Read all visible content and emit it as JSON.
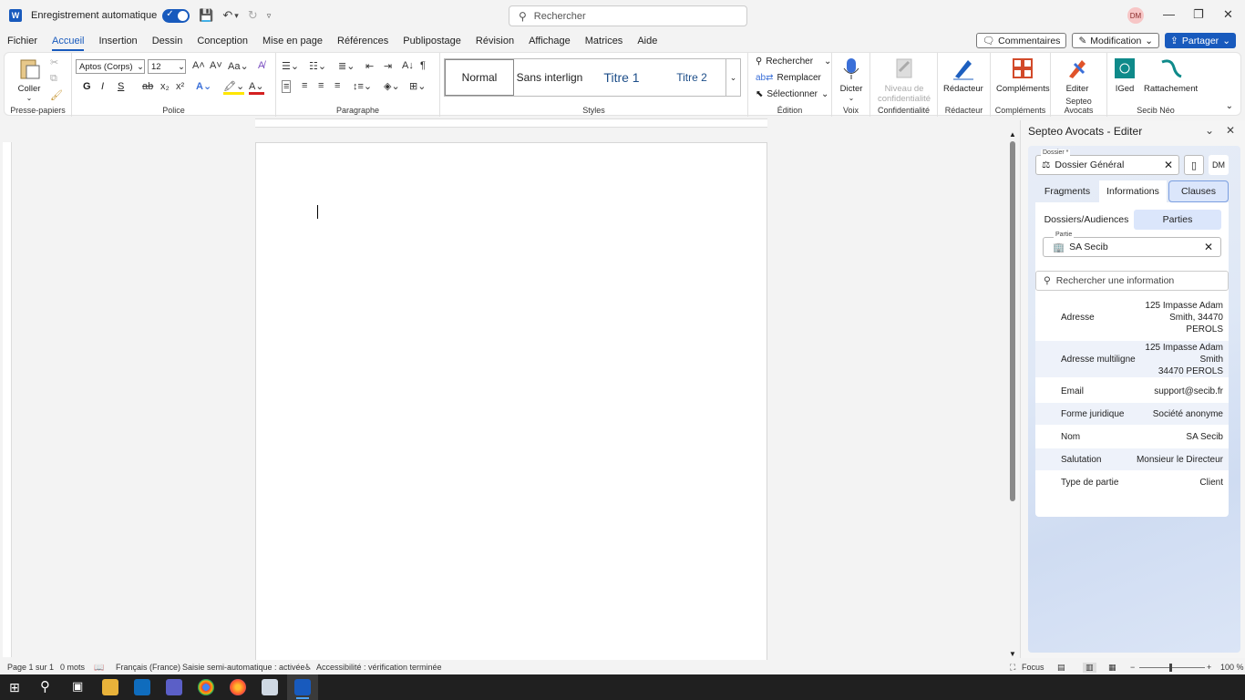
{
  "titlebar": {
    "autosave_label": "Enregistrement automatique",
    "search_placeholder": "Rechercher",
    "user_initials": "DM"
  },
  "menu": {
    "tabs": [
      "Fichier",
      "Accueil",
      "Insertion",
      "Dessin",
      "Conception",
      "Mise en page",
      "Références",
      "Publipostage",
      "Révision",
      "Affichage",
      "Matrices",
      "Aide"
    ],
    "active_tab": "Accueil",
    "comments_label": "Commentaires",
    "modification_label": "Modification",
    "share_label": "Partager"
  },
  "ribbon": {
    "clipboard": {
      "paste_label": "Coller",
      "group_label": "Presse-papiers"
    },
    "font": {
      "font_name": "Aptos (Corps)",
      "font_size": "12",
      "group_label": "Police",
      "bold": "G",
      "italic": "I",
      "underline": "S"
    },
    "paragraph": {
      "group_label": "Paragraphe"
    },
    "styles": {
      "items": [
        "Normal",
        "Sans interlign",
        "Titre 1",
        "Titre 2"
      ],
      "group_label": "Styles"
    },
    "editing": {
      "find_label": "Rechercher",
      "replace_label": "Remplacer",
      "select_label": "Sélectionner",
      "group_label": "Édition"
    },
    "voice": {
      "dictate_label": "Dicter",
      "group_label": "Voix"
    },
    "confidentiality": {
      "level_line1": "Niveau de",
      "level_line2": "confidentialité",
      "group_label": "Confidentialité"
    },
    "redacteur": {
      "label": "Rédacteur",
      "group_label": "Rédacteur"
    },
    "complements": {
      "label": "Compléments",
      "group_label": "Compléments"
    },
    "septeo": {
      "label": "Editer",
      "group_label": "Septeo Avocats"
    },
    "secib": {
      "iged_label": "IGed",
      "rattachement_label": "Rattachement",
      "group_label": "Secib Néo"
    }
  },
  "pane": {
    "title": "Septeo Avocats - Editer",
    "dossier_label": "Dossier *",
    "dossier_value": "Dossier Général",
    "dm_label": "DM",
    "tabs": [
      "Fragments",
      "Informations",
      "Clauses"
    ],
    "active_tab": "Informations",
    "subtabs": [
      "Dossiers/Audiences",
      "Parties"
    ],
    "active_subtab": "Parties",
    "partie_label": "Partie",
    "partie_value": "SA Secib",
    "info_search_placeholder": "Rechercher une information",
    "rows": [
      {
        "key": "Adresse",
        "value_lines": [
          "125 Impasse Adam",
          "Smith, 34470",
          "PEROLS"
        ]
      },
      {
        "key": "Adresse multiligne",
        "value_lines": [
          "125 Impasse Adam",
          "Smith",
          "34470 PEROLS"
        ]
      },
      {
        "key": "Email",
        "value_lines": [
          "support@secib.fr"
        ]
      },
      {
        "key": "Forme juridique",
        "value_lines": [
          "Société anonyme"
        ]
      },
      {
        "key": "Nom",
        "value_lines": [
          "SA Secib"
        ]
      },
      {
        "key": "Salutation",
        "value_lines": [
          "Monsieur le Directeur"
        ]
      },
      {
        "key": "Type de partie",
        "value_lines": [
          "Client"
        ]
      }
    ]
  },
  "status": {
    "page": "Page 1 sur 1",
    "words": "0 mots",
    "language": "Français (France)",
    "autocomplete": "Saisie semi-automatique : activée",
    "accessibility": "Accessibilité : vérification terminée",
    "focus": "Focus",
    "zoom": "100 %"
  },
  "colors": {
    "accent": "#185abd",
    "pane_active_tab": "#dbe6fb"
  }
}
